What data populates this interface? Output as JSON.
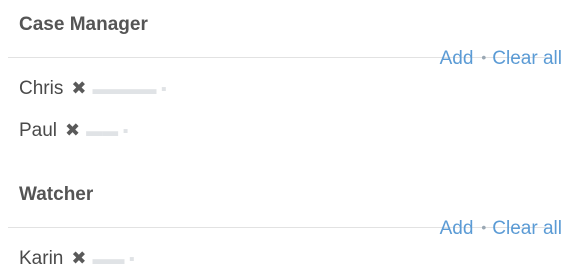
{
  "sections": [
    {
      "title": "Case Manager",
      "add_label": "Add",
      "clear_label": "Clear all",
      "separator": "•",
      "people": [
        {
          "name": "Chris",
          "remove_icon": "✖"
        },
        {
          "name": "Paul",
          "remove_icon": "✖"
        }
      ]
    },
    {
      "title": "Watcher",
      "add_label": "Add",
      "clear_label": "Clear all",
      "separator": "•",
      "people": [
        {
          "name": "Karin",
          "remove_icon": "✖"
        }
      ]
    }
  ],
  "colors": {
    "link": "#5b9bd5",
    "title": "#555555",
    "text": "#4a4a4a",
    "divider": "#e2e2e2"
  }
}
